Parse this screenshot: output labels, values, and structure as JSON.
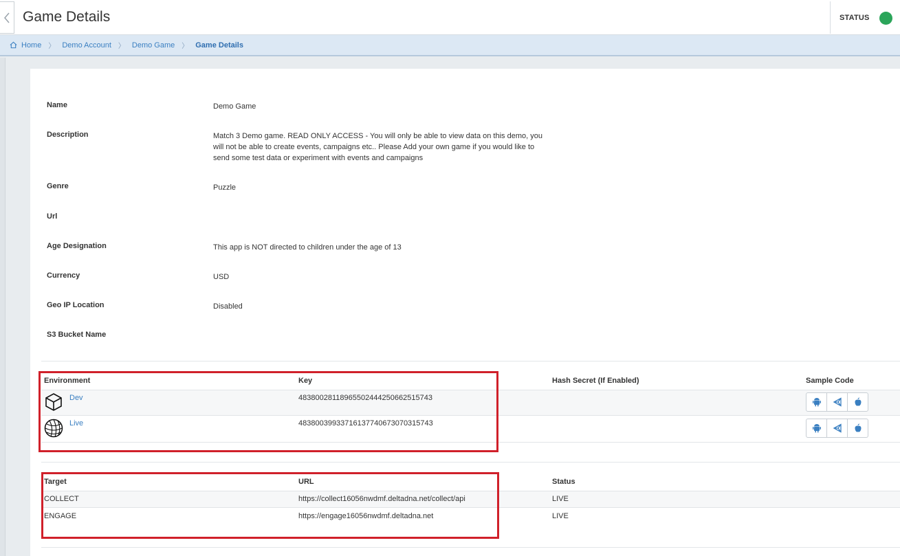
{
  "header": {
    "title": "Game Details",
    "status_label": "STATUS",
    "status_color": "#2ba55a"
  },
  "breadcrumb": {
    "items": [
      "Home",
      "Demo Account",
      "Demo Game",
      "Game Details"
    ]
  },
  "details": [
    {
      "label": "Name",
      "value": "Demo Game"
    },
    {
      "label": "Description",
      "value": "Match 3 Demo game. READ ONLY ACCESS - You will only be able to view data on this demo, you will not be able to create events, campaigns etc.. Please Add your own game if you would like to send some test data or experiment with events and campaigns"
    },
    {
      "label": "Genre",
      "value": "Puzzle"
    },
    {
      "label": "Url",
      "value": ""
    },
    {
      "label": "Age Designation",
      "value": "This app is NOT directed to children under the age of 13"
    },
    {
      "label": "Currency",
      "value": "USD"
    },
    {
      "label": "Geo IP Location",
      "value": "Disabled"
    },
    {
      "label": "S3 Bucket Name",
      "value": ""
    }
  ],
  "environments": {
    "headers": [
      "Environment",
      "Key",
      "Hash Secret (If Enabled)",
      "Sample Code"
    ],
    "rows": [
      {
        "name": "Dev",
        "icon": "cube-icon",
        "key": "48380028118965502444250662515743",
        "hash": ""
      },
      {
        "name": "Live",
        "icon": "globe-icon",
        "key": "48380039933716137740673070315743",
        "hash": ""
      }
    ],
    "sample_icons": [
      "android-icon",
      "unity-icon",
      "apple-icon"
    ]
  },
  "endpoints": {
    "headers": [
      "Target",
      "URL",
      "Status"
    ],
    "rows": [
      {
        "target": "COLLECT",
        "url": "https://collect16056nwdmf.deltadna.net/collect/api",
        "status": "LIVE"
      },
      {
        "target": "ENGAGE",
        "url": "https://engage16056nwdmf.deltadna.net",
        "status": "LIVE"
      }
    ]
  },
  "colors": {
    "accent": "#3a7fc1",
    "highlight": "#d0202a"
  }
}
